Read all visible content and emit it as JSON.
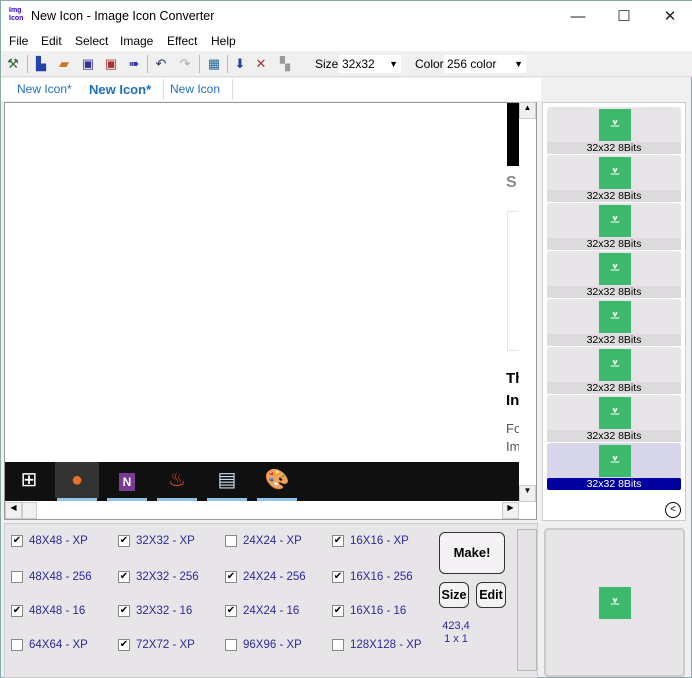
{
  "window": {
    "title": "New Icon - Image Icon Converter",
    "app_icon_text": "Img Icon",
    "minimize": "—",
    "maximize": "☐",
    "close": "✕"
  },
  "menu": [
    "File",
    "Edit",
    "Select",
    "Image",
    "Effect",
    "Help"
  ],
  "toolbar": {
    "size_label": "Size:",
    "size_value": "32x32",
    "color_label": "Color:",
    "color_value": "256 color"
  },
  "tabs": [
    "New Icon*",
    "New Icon*",
    "New Icon"
  ],
  "canvas": {
    "partial_text": [
      "S",
      "Th",
      "In",
      "Fo",
      "Im"
    ]
  },
  "icon_list": {
    "items": [
      "32x32 8Bits",
      "32x32 8Bits",
      "32x32 8Bits",
      "32x32 8Bits",
      "32x32 8Bits",
      "32x32 8Bits",
      "32x32 8Bits",
      "32x32 8Bits"
    ],
    "selected_index": 7
  },
  "formats": [
    {
      "label": "48X48 - XP",
      "checked": true
    },
    {
      "label": "32X32 - XP",
      "checked": true
    },
    {
      "label": "24X24 - XP",
      "checked": false
    },
    {
      "label": "16X16 - XP",
      "checked": true
    },
    {
      "label": "48X48 - 256",
      "checked": false
    },
    {
      "label": "32X32 - 256",
      "checked": true
    },
    {
      "label": "24X24 - 256",
      "checked": true
    },
    {
      "label": "16X16 - 256",
      "checked": true
    },
    {
      "label": "48X48 - 16",
      "checked": true
    },
    {
      "label": "32X32 - 16",
      "checked": true
    },
    {
      "label": "24X24 - 16",
      "checked": true
    },
    {
      "label": "16X16 - 16",
      "checked": true
    },
    {
      "label": "64X64 - XP",
      "checked": false
    },
    {
      "label": "72X72 - XP",
      "checked": true
    },
    {
      "label": "96X96 - XP",
      "checked": false
    },
    {
      "label": "128X128 - XP",
      "checked": false
    }
  ],
  "buttons": {
    "make": "Make!",
    "size": "Size",
    "edit": "Edit"
  },
  "status": {
    "coords": "423,4",
    "selection": "1 x 1"
  },
  "colors": {
    "icon_green": "#3cb96a",
    "selected_label": "#0000a0",
    "text_blue": "#2a2aa0"
  }
}
